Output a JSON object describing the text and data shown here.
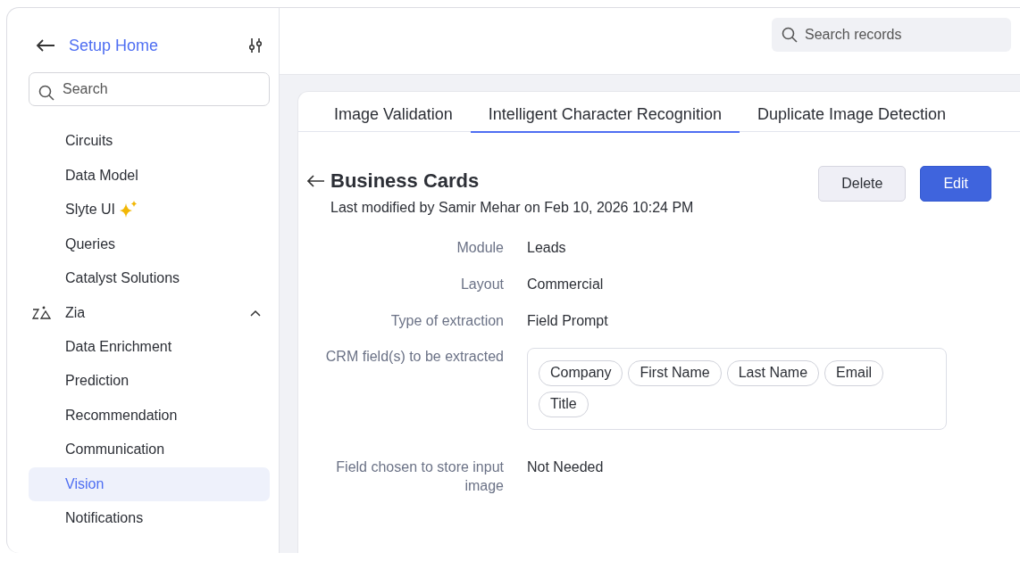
{
  "sidebar": {
    "back_label": "Setup Home",
    "search": {
      "placeholder": "Search"
    },
    "items": [
      {
        "label": "Circuits",
        "selected": false
      },
      {
        "label": "Data Model",
        "selected": false
      },
      {
        "label": "Slyte UI",
        "selected": false,
        "sparkle": true
      },
      {
        "label": "Queries",
        "selected": false
      },
      {
        "label": "Catalyst Solutions",
        "selected": false
      },
      {
        "label": "Zia",
        "selected": false,
        "expanded": true,
        "children": [
          {
            "label": "Data Enrichment",
            "selected": false
          },
          {
            "label": "Prediction",
            "selected": false
          },
          {
            "label": "Recommendation",
            "selected": false
          },
          {
            "label": "Communication",
            "selected": false
          },
          {
            "label": "Vision",
            "selected": true
          },
          {
            "label": "Notifications",
            "selected": false
          }
        ]
      }
    ]
  },
  "topbar": {
    "search": {
      "placeholder": "Search records"
    }
  },
  "tabs": [
    {
      "label": "Image Validation",
      "selected": false
    },
    {
      "label": "Intelligent Character Recognition",
      "selected": true
    },
    {
      "label": "Duplicate Image Detection",
      "selected": false
    }
  ],
  "record": {
    "title": "Business Cards",
    "subtitle": "Last modified by Samir Mehar on Feb 10, 2026 10:24 PM",
    "buttons": [
      {
        "label": "Delete",
        "kind": "secondary"
      },
      {
        "label": "Edit",
        "kind": "primary"
      }
    ],
    "fields": [
      {
        "label": "Module",
        "kind": "text",
        "value": "Leads"
      },
      {
        "label": "Layout",
        "kind": "text",
        "value": "Commercial"
      },
      {
        "label": "Type of extraction",
        "kind": "text",
        "value": "Field Prompt"
      },
      {
        "label": "CRM field(s) to be extracted",
        "kind": "chips",
        "chips": [
          "Company",
          "First Name",
          "Last Name",
          "Email",
          "Title"
        ]
      },
      {
        "label": "Field chosen to store input image",
        "kind": "text",
        "value": "Not Needed"
      }
    ]
  }
}
